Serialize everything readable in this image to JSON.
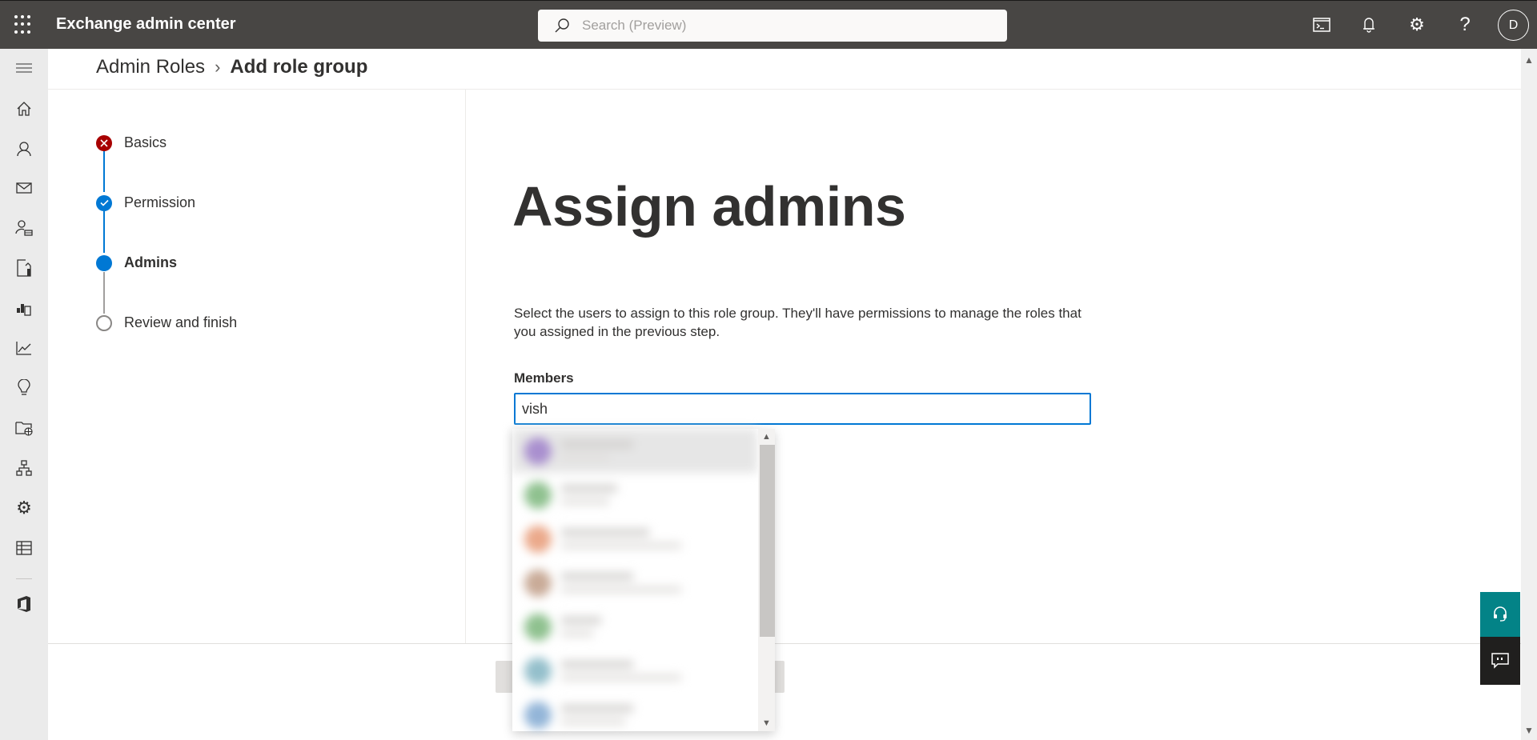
{
  "app": {
    "title": "Exchange admin center",
    "search_placeholder": "Search (Preview)",
    "avatar_initial": "D",
    "header_icons": [
      "cloud-shell-icon",
      "notifications-icon",
      "settings-icon",
      "help-icon"
    ]
  },
  "sidebar": {
    "items": [
      {
        "icon": "hamburger-icon",
        "label": "Collapse navigation"
      },
      {
        "icon": "home-icon",
        "label": "Home"
      },
      {
        "icon": "recipients-icon",
        "label": "Recipients"
      },
      {
        "icon": "mail-flow-icon",
        "label": "Mail flow"
      },
      {
        "icon": "roles-icon",
        "label": "Roles"
      },
      {
        "icon": "migration-icon",
        "label": "Migration"
      },
      {
        "icon": "mobile-icon",
        "label": "Mobile"
      },
      {
        "icon": "reports-icon",
        "label": "Reports"
      },
      {
        "icon": "insights-icon",
        "label": "Insights"
      },
      {
        "icon": "public-folders-icon",
        "label": "Public folders"
      },
      {
        "icon": "organization-icon",
        "label": "Organization"
      },
      {
        "icon": "settings-icon",
        "label": "Settings"
      },
      {
        "icon": "other-features-icon",
        "label": "Other features"
      },
      {
        "icon": "office-icon",
        "label": "Microsoft 365"
      }
    ]
  },
  "breadcrumb": {
    "parent": "Admin Roles",
    "current": "Add role group"
  },
  "wizard": {
    "steps": [
      {
        "label": "Basics",
        "status": "error"
      },
      {
        "label": "Permission",
        "status": "completed"
      },
      {
        "label": "Admins",
        "status": "current"
      },
      {
        "label": "Review and finish",
        "status": "pending"
      }
    ]
  },
  "main": {
    "title": "Assign admins",
    "description": "Select the users to assign to this role group. They'll have permissions to manage the roles that you assigned in the previous step.",
    "members_label": "Members",
    "members_value": "vish"
  },
  "suggestions": {
    "note": "entries blurred/unreadable",
    "avatar_colors": [
      "#a98fcf",
      "#8fc18f",
      "#eba98b",
      "#c9ab98",
      "#8fc18f",
      "#94bfcb",
      "#93b5d8"
    ]
  },
  "colors": {
    "accent": "#0078d4",
    "error": "#a80000",
    "topbar": "#484644",
    "help_button": "#038387"
  }
}
